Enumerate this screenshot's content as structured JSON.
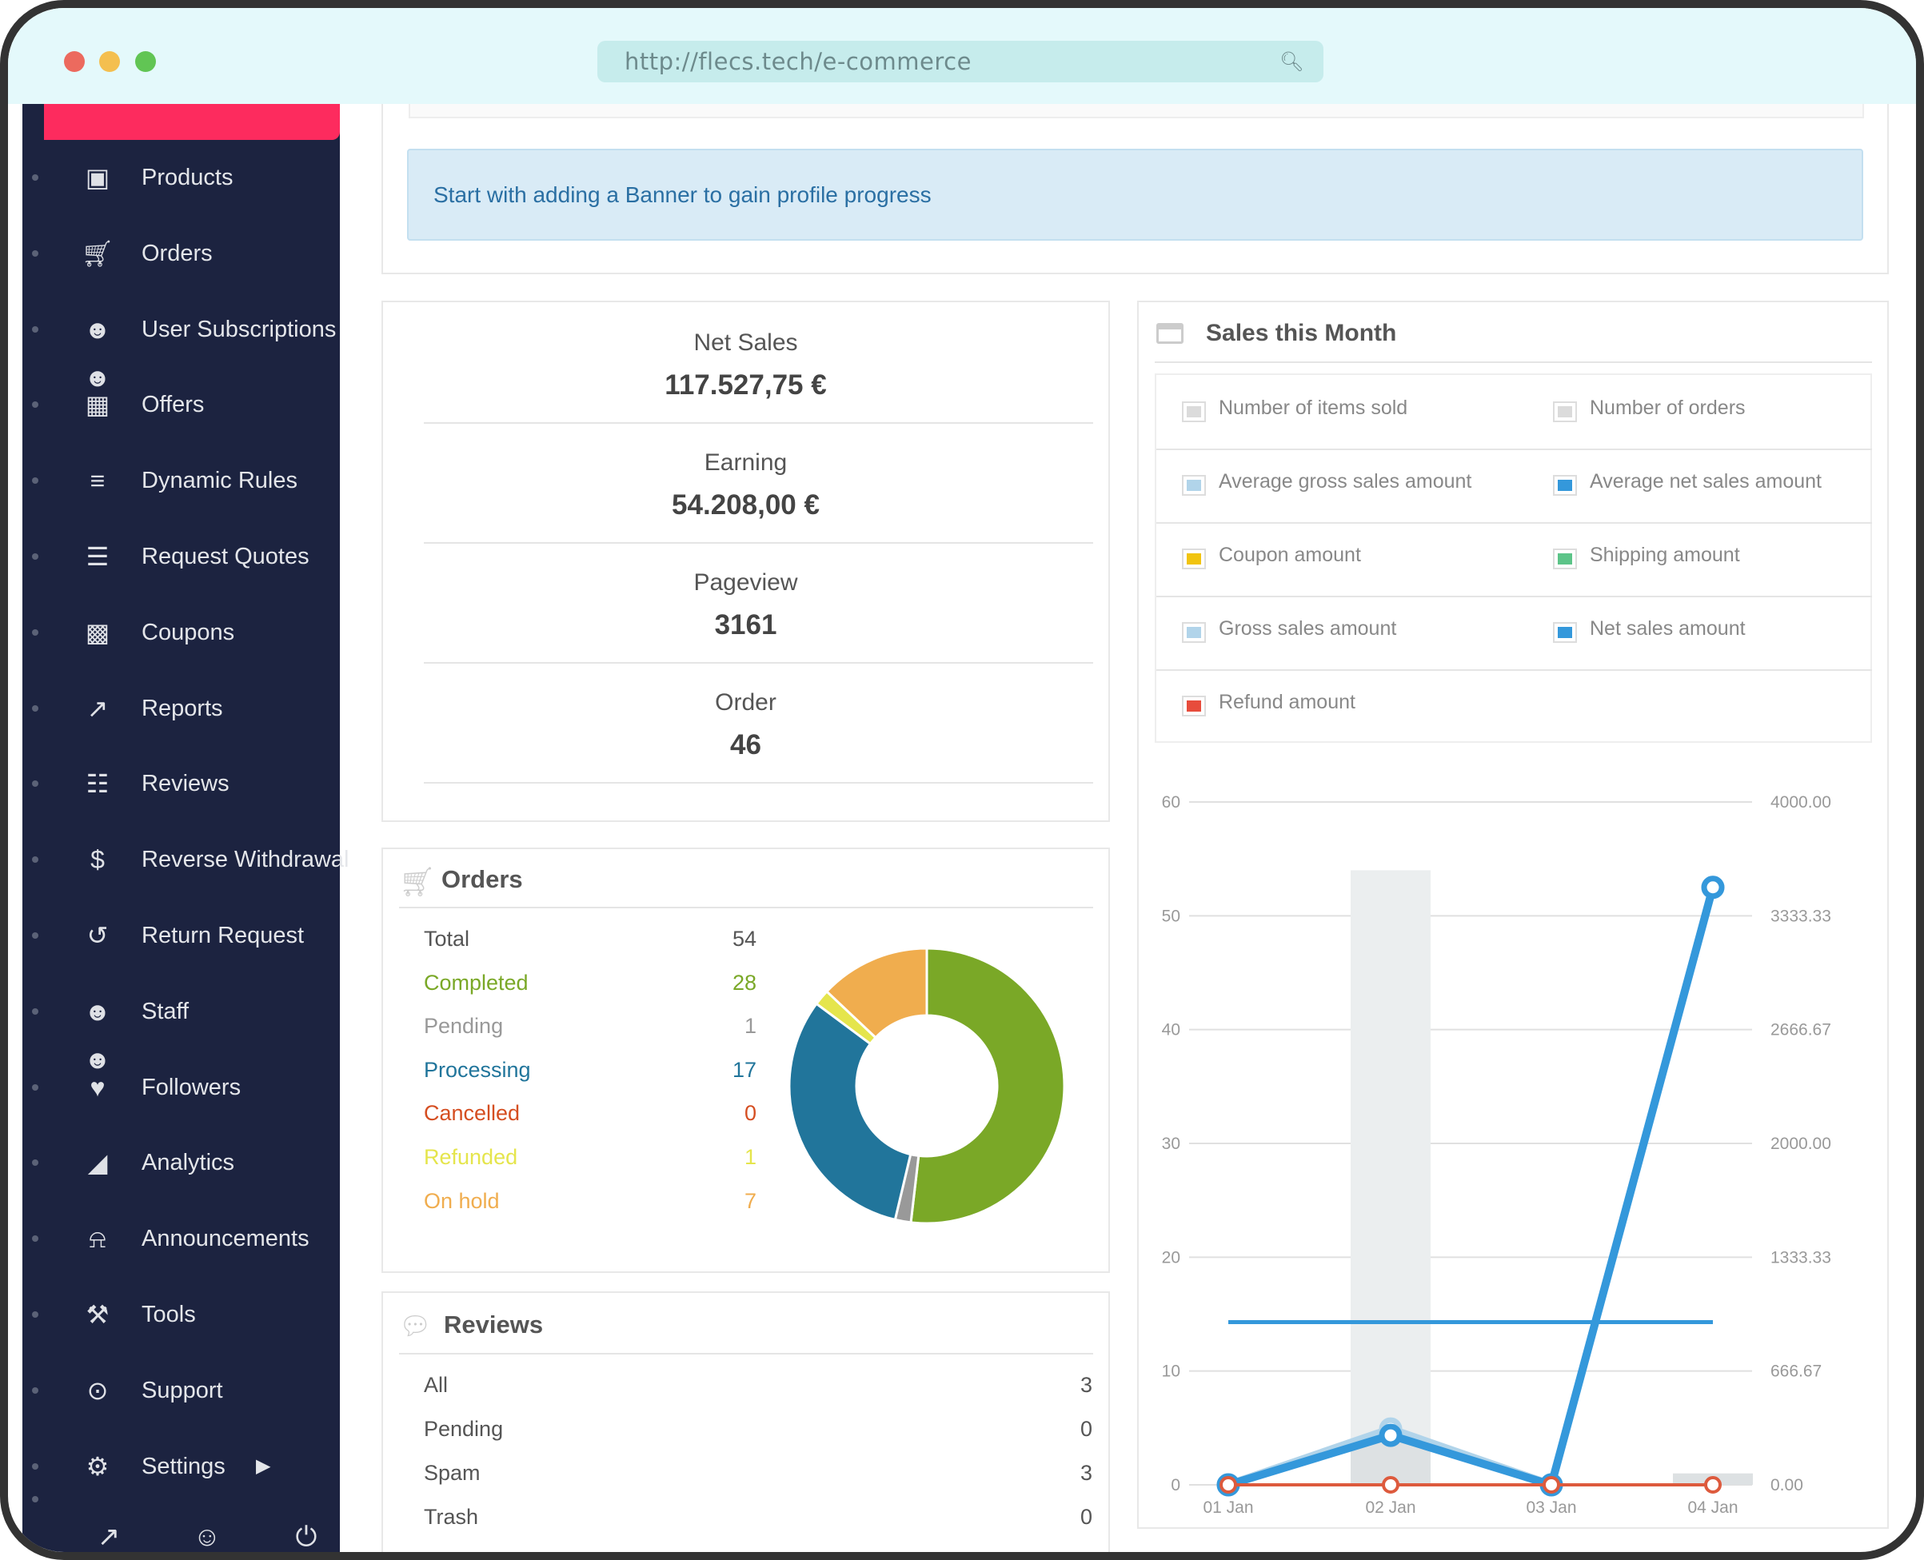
{
  "browser": {
    "url": "http://flecs.tech/e-commerce",
    "dots": [
      "#ec6a5e",
      "#f4bf4f",
      "#61c554"
    ]
  },
  "sidebar": {
    "items": [
      {
        "label": "Products",
        "icon": "briefcase-icon"
      },
      {
        "label": "Orders",
        "icon": "cart-icon"
      },
      {
        "label": "User Subscriptions",
        "icon": "users-icon"
      },
      {
        "label": "Offers",
        "icon": "boxes-icon"
      },
      {
        "label": "Dynamic Rules",
        "icon": "layers-icon"
      },
      {
        "label": "Request Quotes",
        "icon": "list-icon"
      },
      {
        "label": "Coupons",
        "icon": "gift-icon"
      },
      {
        "label": "Reports",
        "icon": "line-chart-icon"
      },
      {
        "label": "Reviews",
        "icon": "comments-icon"
      },
      {
        "label": "Reverse Withdrawal",
        "icon": "dollar-icon"
      },
      {
        "label": "Return Request",
        "icon": "undo-icon"
      },
      {
        "label": "Staff",
        "icon": "users-icon"
      },
      {
        "label": "Followers",
        "icon": "heart-icon"
      },
      {
        "label": "Analytics",
        "icon": "area-chart-icon"
      },
      {
        "label": "Announcements",
        "icon": "bell-icon"
      },
      {
        "label": "Tools",
        "icon": "wrench-icon"
      },
      {
        "label": "Support",
        "icon": "lifebuoy-icon"
      },
      {
        "label": "Settings",
        "icon": "gear-icon",
        "has_submenu": true
      }
    ],
    "bottom_icons": [
      "external-link-icon",
      "user-icon",
      "power-icon"
    ]
  },
  "banner": {
    "text": "Start with adding a Banner to gain profile progress"
  },
  "stats": [
    {
      "label": "Net Sales",
      "value": "117.527,75 €"
    },
    {
      "label": "Earning",
      "value": "54.208,00 €"
    },
    {
      "label": "Pageview",
      "value": "3161"
    },
    {
      "label": "Order",
      "value": "46"
    }
  ],
  "orders": {
    "title": "Orders",
    "rows": [
      {
        "label": "Total",
        "value": "54",
        "color": "#555555"
      },
      {
        "label": "Completed",
        "value": "28",
        "color": "#7aa827"
      },
      {
        "label": "Pending",
        "value": "1",
        "color": "#999999"
      },
      {
        "label": "Processing",
        "value": "17",
        "color": "#21759b"
      },
      {
        "label": "Cancelled",
        "value": "0",
        "color": "#d54e21"
      },
      {
        "label": "Refunded",
        "value": "1",
        "color": "#e5e54c"
      },
      {
        "label": "On hold",
        "value": "7",
        "color": "#f0ad4e"
      }
    ]
  },
  "reviews": {
    "title": "Reviews",
    "rows": [
      {
        "label": "All",
        "value": "3"
      },
      {
        "label": "Pending",
        "value": "0"
      },
      {
        "label": "Spam",
        "value": "3"
      },
      {
        "label": "Trash",
        "value": "0"
      }
    ]
  },
  "sales": {
    "title": "Sales this Month",
    "legend": [
      {
        "label": "Number of items sold",
        "color": "#dbdbdb"
      },
      {
        "label": "Number of orders",
        "color": "#dbdbdb"
      },
      {
        "label": "Average gross sales amount",
        "color": "#b1d4ea"
      },
      {
        "label": "Average net sales amount",
        "color": "#3498db"
      },
      {
        "label": "Coupon amount",
        "color": "#f1c40f"
      },
      {
        "label": "Shipping amount",
        "color": "#5cc488"
      },
      {
        "label": "Gross sales amount",
        "color": "#b1d4ea"
      },
      {
        "label": "Net sales amount",
        "color": "#3498db"
      },
      {
        "label": "Refund amount",
        "color": "#e74c3c"
      }
    ]
  },
  "chart_data": {
    "type": "bar",
    "categories": [
      "01 Jan",
      "02 Jan",
      "03 Jan",
      "04 Jan"
    ],
    "y_left": {
      "ticks": [
        "0",
        "10",
        "20",
        "30",
        "40",
        "50",
        "60"
      ],
      "range": [
        0,
        60
      ]
    },
    "y_right": {
      "ticks": [
        "0.00",
        "666.67",
        "1333.33",
        "2000.00",
        "2666.67",
        "3333.33",
        "4000.00"
      ],
      "range": [
        0,
        4000
      ]
    },
    "grid": true,
    "series": [
      {
        "name": "Number of items sold",
        "type": "bar",
        "axis": "left",
        "values": [
          0,
          54,
          0,
          1
        ],
        "color": "#ebeeef"
      },
      {
        "name": "Number of orders",
        "type": "bar",
        "axis": "left",
        "values": [
          0,
          4,
          0,
          1
        ],
        "color": "#dde1e3"
      },
      {
        "name": "Gross sales amount",
        "type": "line",
        "axis": "right",
        "values": [
          0,
          327,
          0,
          3500
        ],
        "color": "#b1d4ea"
      },
      {
        "name": "Net sales amount",
        "type": "line",
        "axis": "right",
        "values": [
          0,
          290,
          0,
          3500
        ],
        "color": "#3498db"
      },
      {
        "name": "Average net sales amount",
        "type": "line",
        "axis": "right",
        "values": [
          953,
          953,
          953,
          953
        ],
        "color": "#3498db"
      },
      {
        "name": "Refund amount",
        "type": "line",
        "axis": "right",
        "values": [
          0,
          0,
          0,
          0
        ],
        "color": "#dd5a3d"
      }
    ]
  }
}
